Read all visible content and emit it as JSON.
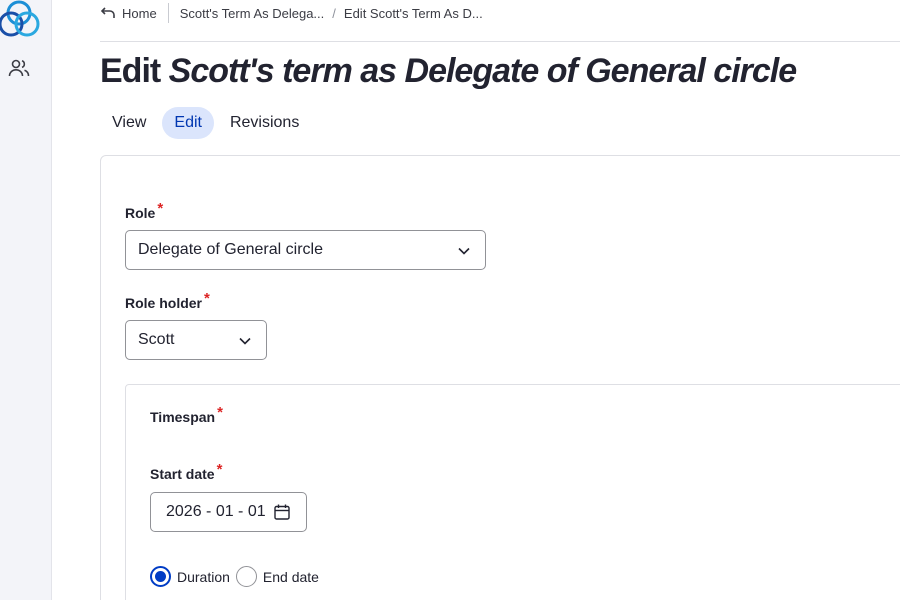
{
  "breadcrumb": {
    "home": "Home",
    "item1": "Scott's Term As Delega...",
    "item2": "Edit Scott's Term As D..."
  },
  "title": {
    "prefix": "Edit",
    "entity": "Scott's term as Delegate of General circle"
  },
  "tabs": [
    {
      "label": "View"
    },
    {
      "label": "Edit",
      "active": true
    },
    {
      "label": "Revisions"
    }
  ],
  "form": {
    "role": {
      "label": "Role",
      "required_mark": "*",
      "value": "Delegate of General circle"
    },
    "role_holder": {
      "label": "Role holder",
      "required_mark": "*",
      "value": "Scott"
    },
    "timespan": {
      "label": "Timespan",
      "required_mark": "*"
    },
    "start_date": {
      "label": "Start date",
      "required_mark": "*",
      "value": "2026 - 01 - 01"
    },
    "end_mode": {
      "options": [
        {
          "label": "Duration",
          "checked": true
        },
        {
          "label": "End date",
          "checked": false
        }
      ]
    }
  },
  "icons": {
    "logo": "app-logo",
    "sidebar": "people-icon",
    "back": "back-arrow-icon",
    "chevron": "chevron-down-icon",
    "calendar": "calendar-icon"
  },
  "colors": {
    "accent": "#003cc5",
    "tab_active_bg": "#dbe5fc",
    "required": "#dc2323"
  }
}
